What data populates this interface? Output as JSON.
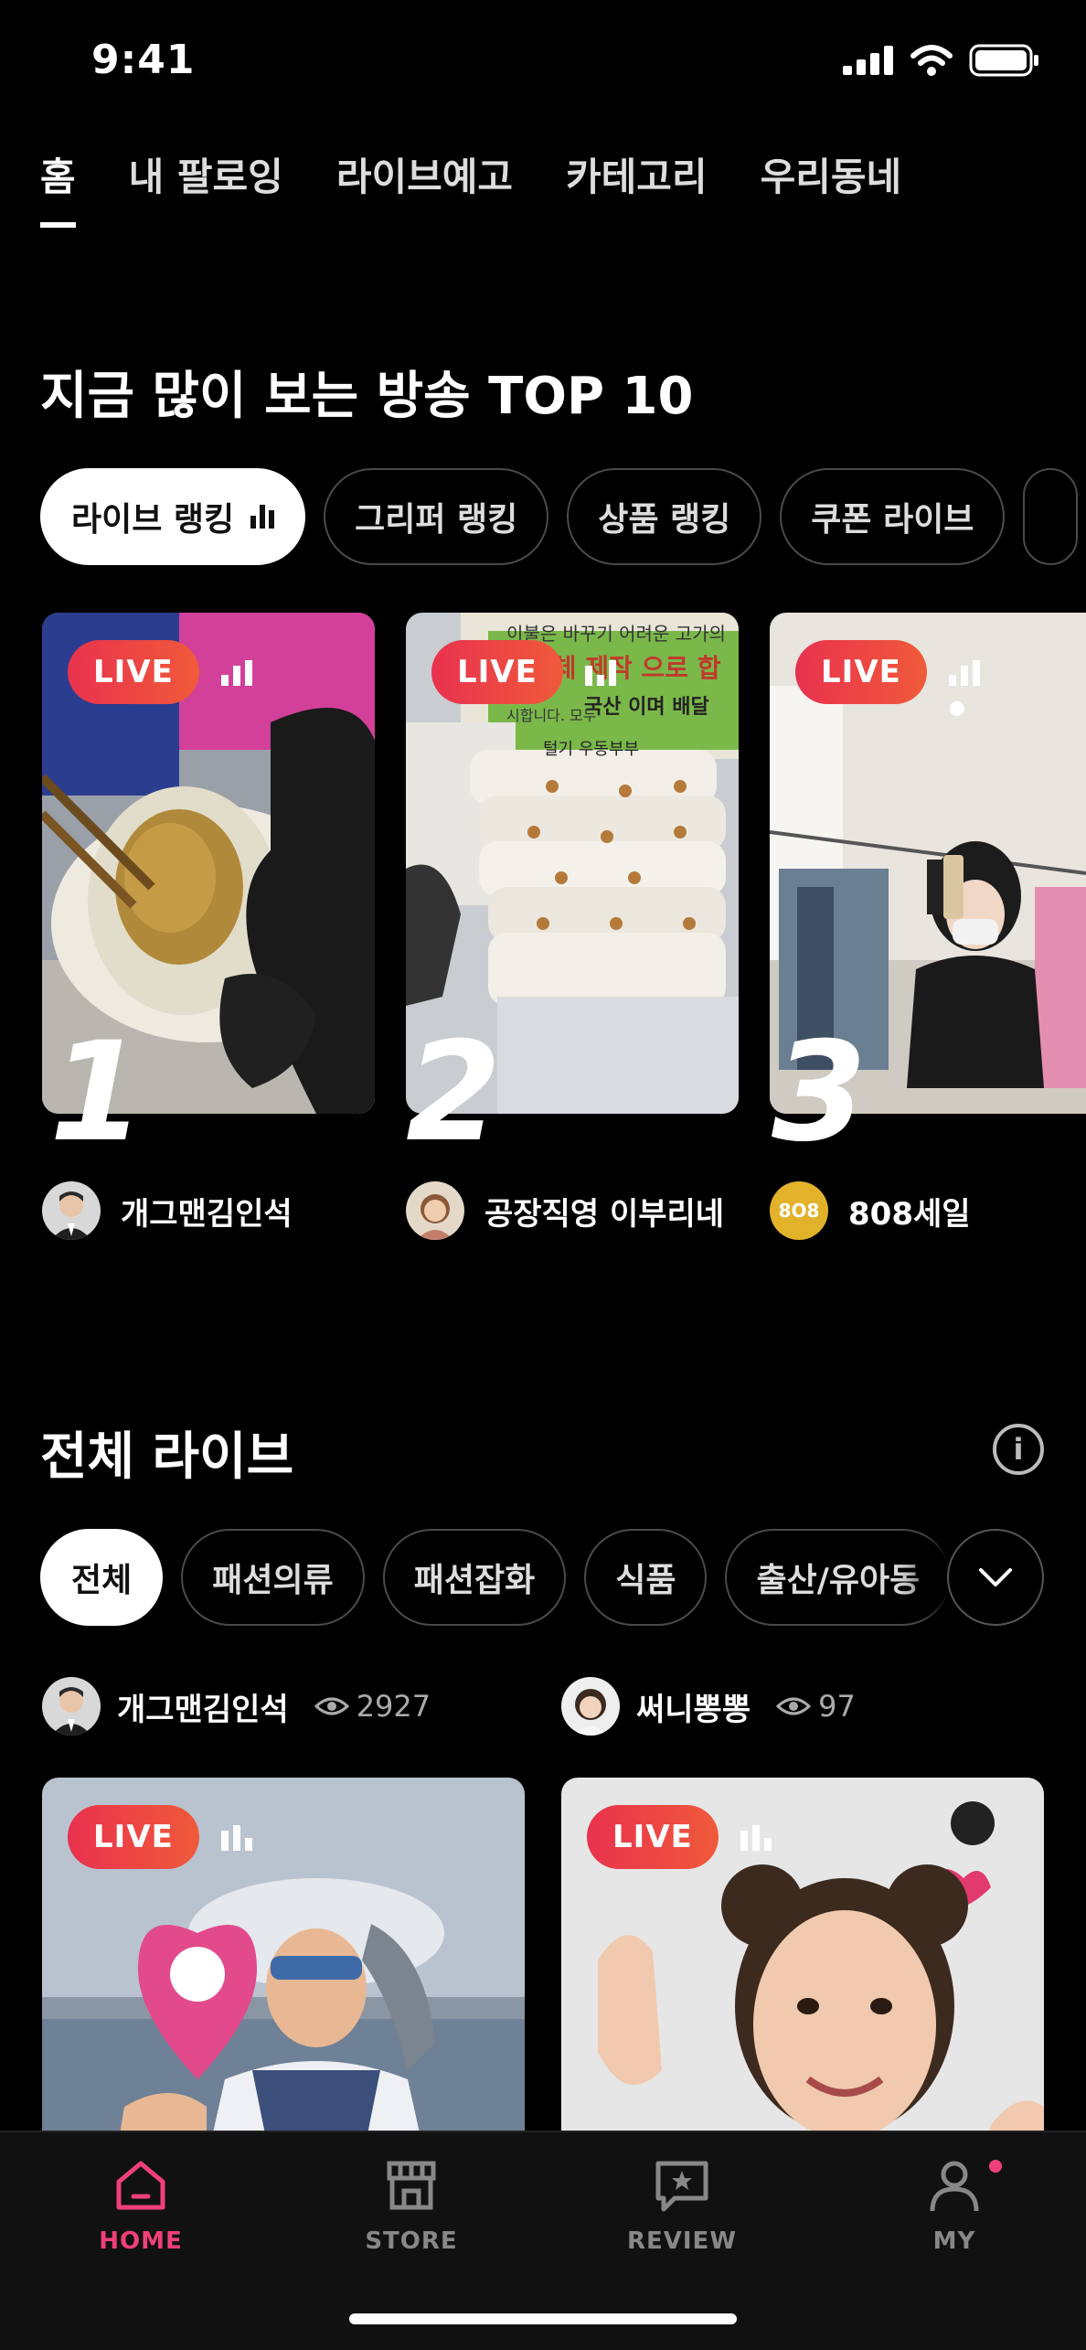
{
  "status_bar": {
    "time": "9:41"
  },
  "top_tabs": [
    {
      "label": "홈",
      "active": true
    },
    {
      "label": "내 팔로잉"
    },
    {
      "label": "라이브예고"
    },
    {
      "label": "카테고리"
    },
    {
      "label": "우리동네"
    }
  ],
  "ranking": {
    "title": "지금 많이 보는 방송 TOP 10",
    "chips": [
      "라이브 랭킹",
      "그리퍼 랭킹",
      "상품 랭킹",
      "쿠폰 라이브"
    ],
    "cards": [
      {
        "rank": "1",
        "badge": "LIVE",
        "seller": "개그맨김인석"
      },
      {
        "rank": "2",
        "badge": "LIVE",
        "seller": "공장직영 이부리네"
      },
      {
        "rank": "3",
        "badge": "LIVE",
        "seller": "808세일",
        "avatar_text": "8O8"
      }
    ],
    "banner_text": {
      "line1": "이불은 바꾸기 어려운 고가의",
      "line2": "자체 제작 으로 합",
      "line3": "국산 이며 배달",
      "line4": "시합니다. 모두",
      "line5": "털기 우동부부"
    }
  },
  "all_live": {
    "title": "전체 라이브",
    "chips": [
      "전체",
      "패션의류",
      "패션잡화",
      "식품",
      "출산/유아동"
    ],
    "streams": [
      {
        "seller": "개그맨김인석",
        "viewers": "2927",
        "badge": "LIVE"
      },
      {
        "seller": "써니뽕뽕",
        "viewers": "97",
        "badge": "LIVE"
      }
    ]
  },
  "bottom_nav": [
    {
      "label": "HOME",
      "icon": "home-icon",
      "active": true
    },
    {
      "label": "STORE",
      "icon": "store-icon"
    },
    {
      "label": "REVIEW",
      "icon": "review-icon"
    },
    {
      "label": "MY",
      "icon": "profile-icon",
      "badge_dot": true
    }
  ],
  "colors": {
    "accent": "#f0407a",
    "live_badge": "#e8324e",
    "background": "#000000"
  }
}
